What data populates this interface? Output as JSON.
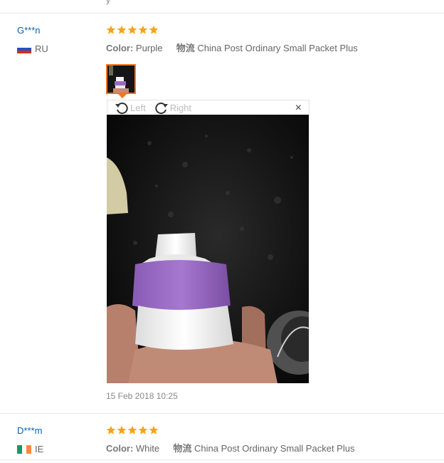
{
  "top_partial_text": "y",
  "reviews": [
    {
      "user": "G***n",
      "country": "RU",
      "rating": 5,
      "color_label": "Color:",
      "color_value": "Purple",
      "shipping_label": "物流",
      "shipping_value": "China Post Ordinary Small Packet Plus",
      "date": "15 Feb 2018 10:25"
    },
    {
      "user": "D***m",
      "country": "IE",
      "rating": 5,
      "color_label": "Color:",
      "color_value": "White",
      "shipping_label": "物流",
      "shipping_value": "China Post Ordinary Small Packet Plus"
    }
  ],
  "viewer": {
    "rotate_left": "Left",
    "rotate_right": "Right",
    "close": "×"
  },
  "colors": {
    "username": "#0a5eb0",
    "star": "#f7a21b",
    "thumb_border": "#f6751b"
  }
}
